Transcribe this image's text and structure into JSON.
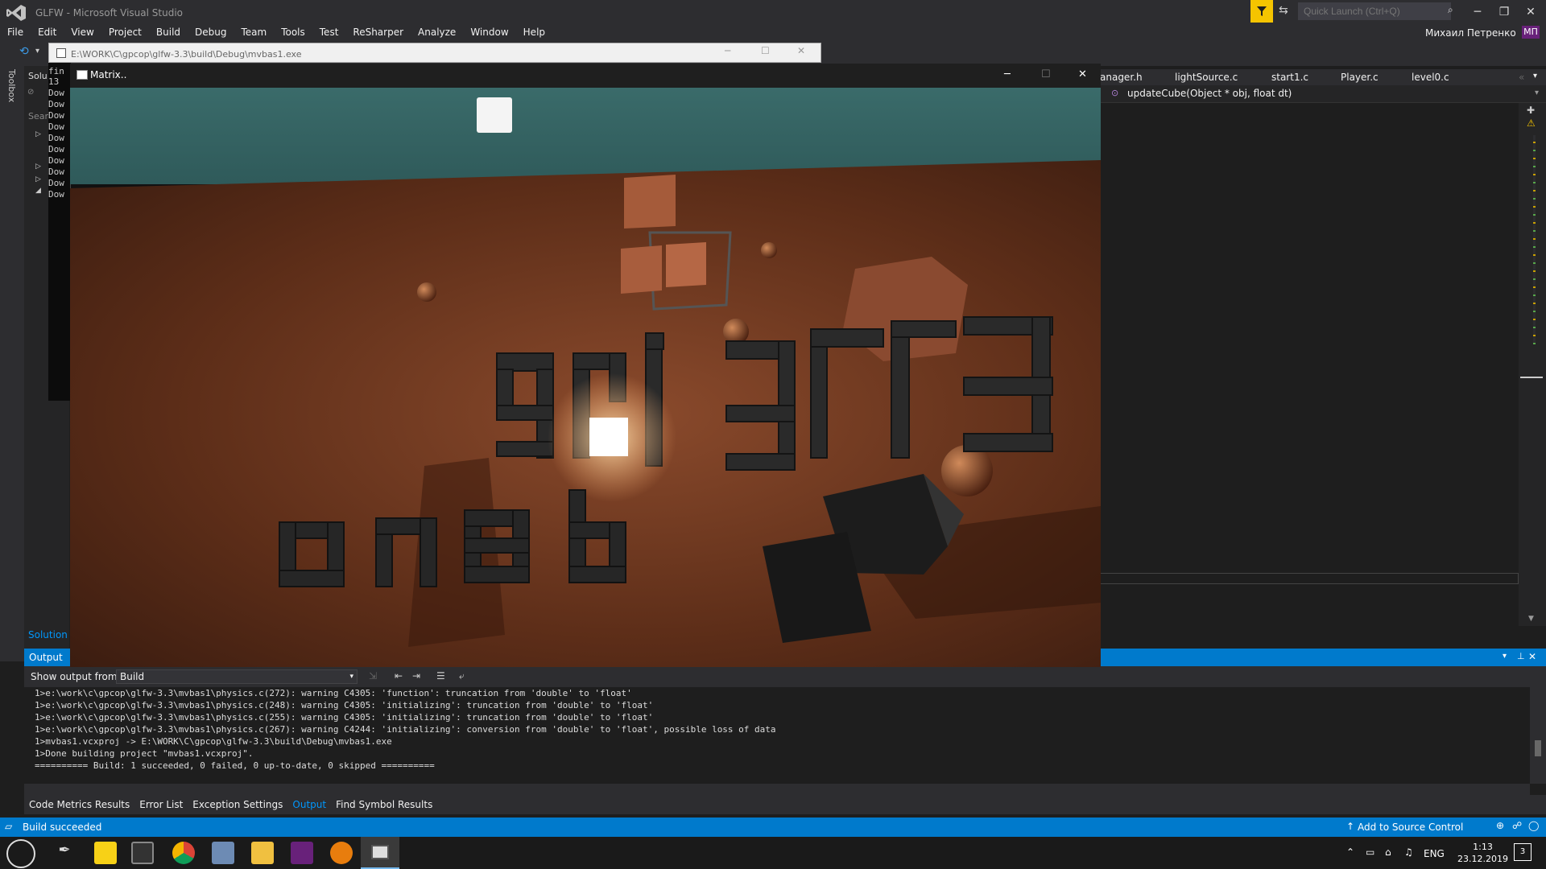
{
  "app_title": "GLFW - Microsoft Visual Studio",
  "quick_launch_placeholder": "Quick Launch (Ctrl+Q)",
  "menu": [
    "File",
    "Edit",
    "View",
    "Project",
    "Build",
    "Debug",
    "Team",
    "Tools",
    "Test",
    "ReSharper",
    "Analyze",
    "Window",
    "Help"
  ],
  "user": {
    "name": "Михаил Петренко",
    "initials": "МП"
  },
  "toolbox_label": "Toolbox",
  "solution_tab": "Solution",
  "console": {
    "title": "E:\\WORK\\C\\gpcop\\glfw-3.3\\build\\Debug\\mvbas1.exe",
    "lines": [
      "fin",
      "13",
      "Dow",
      "Dow",
      "Dow",
      "Dow",
      "Dow",
      "Dow",
      "Dow",
      "Dow",
      "Dow",
      "Dow"
    ]
  },
  "solution_partial": [
    "Solu",
    "Sear"
  ],
  "editor": {
    "tabs": [
      "anager.h",
      "lightSource.c",
      "start1.c",
      "Player.c",
      "level0.c"
    ],
    "nav_function": "updateCube(Object * obj, float dt)"
  },
  "game_window": {
    "title": "Matrix..",
    "text_upper": "9ᑎᒧ3ᒥᒥЗ",
    "text_lower": "омаb"
  },
  "output": {
    "tab_label": "Output",
    "show_from_label": "Show output from:",
    "show_from_value": "Build",
    "lines": [
      "1>e:\\work\\c\\gpcop\\glfw-3.3\\mvbas1\\physics.c(272): warning C4305: 'function': truncation from 'double' to 'float'",
      "1>e:\\work\\c\\gpcop\\glfw-3.3\\mvbas1\\physics.c(248): warning C4305: 'initializing': truncation from 'double' to 'float'",
      "1>e:\\work\\c\\gpcop\\glfw-3.3\\mvbas1\\physics.c(255): warning C4305: 'initializing': truncation from 'double' to 'float'",
      "1>e:\\work\\c\\gpcop\\glfw-3.3\\mvbas1\\physics.c(267): warning C4244: 'initializing': conversion from 'double' to 'float', possible loss of data",
      "1>mvbas1.vcxproj -> E:\\WORK\\C\\gpcop\\glfw-3.3\\build\\Debug\\mvbas1.exe",
      "1>Done building project \"mvbas1.vcxproj\".",
      "========== Build: 1 succeeded, 0 failed, 0 up-to-date, 0 skipped =========="
    ]
  },
  "bottom_tabs": [
    "Code Metrics Results",
    "Error List",
    "Exception Settings",
    "Output",
    "Find Symbol Results"
  ],
  "active_bottom_tab": "Output",
  "status": {
    "text": "Build succeeded",
    "source_control": "Add to Source Control"
  },
  "tray": {
    "lang": "ENG",
    "time": "1:13",
    "date": "23.12.2019",
    "notifications": "3"
  },
  "colors": {
    "accent": "#007acc",
    "vs_purple": "#68217a",
    "filter_yellow": "#f5c400"
  }
}
